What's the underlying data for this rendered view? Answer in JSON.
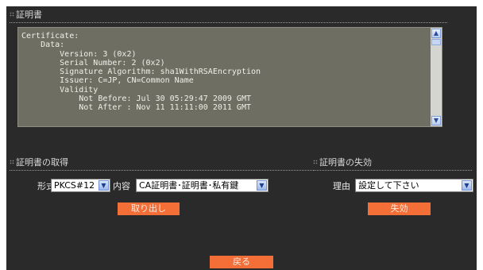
{
  "certificate": {
    "title": "証明書",
    "text": "Certificate:\n    Data:\n        Version: 3 (0x2)\n        Serial Number: 2 (0x2)\n        Signature Algorithm: sha1WithRSAEncryption\n        Issuer: C=JP, CN=Common Name\n        Validity\n            Not Before: Jul 30 05:29:47 2009 GMT\n            Not After : Nov 11 11:11:00 2011 GMT"
  },
  "get_section": {
    "title": "証明書の取得",
    "format_label": "形式",
    "format_value": "PKCS#12",
    "content_label": "内容",
    "content_value": "CA証明書･証明書･私有鍵",
    "button": "取り出し"
  },
  "revoke_section": {
    "title": "証明書の失効",
    "reason_label": "理由",
    "reason_value": "設定して下さい",
    "button": "失効"
  },
  "back_button": "戻る",
  "icons": {
    "scroll_up": "chevron-up-icon",
    "scroll_down": "chevron-down-icon",
    "dropdown": "chevron-down-icon"
  },
  "colors": {
    "background": "#2a2a2a",
    "text_box": "#6e6e63",
    "button": "#f46e38"
  }
}
